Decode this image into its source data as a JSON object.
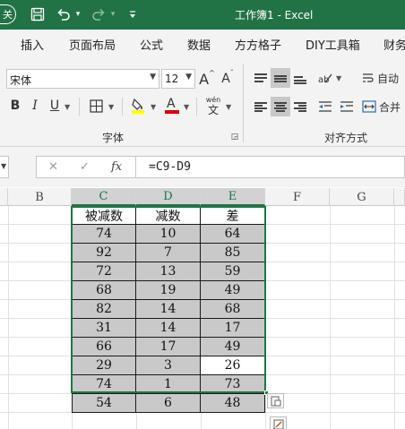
{
  "title_bar": {
    "autosave_label": "关",
    "save_icon": "save-icon",
    "undo_icon": "undo-icon",
    "redo_icon": "redo-icon",
    "title": "工作簿1  -  Excel"
  },
  "ribbon_tabs": [
    "插入",
    "页面布局",
    "公式",
    "数据",
    "方方格子",
    "DIY工具箱",
    "财务"
  ],
  "font_group": {
    "font_name": "宋体",
    "font_size": "12",
    "grow_label": "A",
    "shrink_label": "A",
    "bold": "B",
    "italic": "I",
    "underline": "U",
    "font_color_label": "A",
    "phonetic_top": "wén",
    "phonetic_bottom": "文",
    "label": "字体",
    "fill_color": "#ffff00",
    "font_color": "#e00000"
  },
  "align_group": {
    "wrap_label": "自动",
    "merge_label": "合并",
    "label": "对齐方式"
  },
  "formula_bar": {
    "cancel": "✕",
    "enter": "✓",
    "fx": "fx",
    "formula": "=C9-D9"
  },
  "columns": [
    "B",
    "C",
    "D",
    "E",
    "F",
    "G"
  ],
  "table": {
    "headers": [
      "被减数",
      "减数",
      "差"
    ],
    "rows": [
      [
        "74",
        "10",
        "64"
      ],
      [
        "92",
        "7",
        "85"
      ],
      [
        "72",
        "13",
        "59"
      ],
      [
        "68",
        "19",
        "49"
      ],
      [
        "82",
        "14",
        "68"
      ],
      [
        "31",
        "14",
        "17"
      ],
      [
        "66",
        "17",
        "49"
      ],
      [
        "29",
        "3",
        "26"
      ],
      [
        "74",
        "1",
        "73"
      ],
      [
        "54",
        "6",
        "48"
      ]
    ]
  },
  "colors": {
    "accent": "#217346",
    "cell_fill": "#c9c9c9"
  }
}
